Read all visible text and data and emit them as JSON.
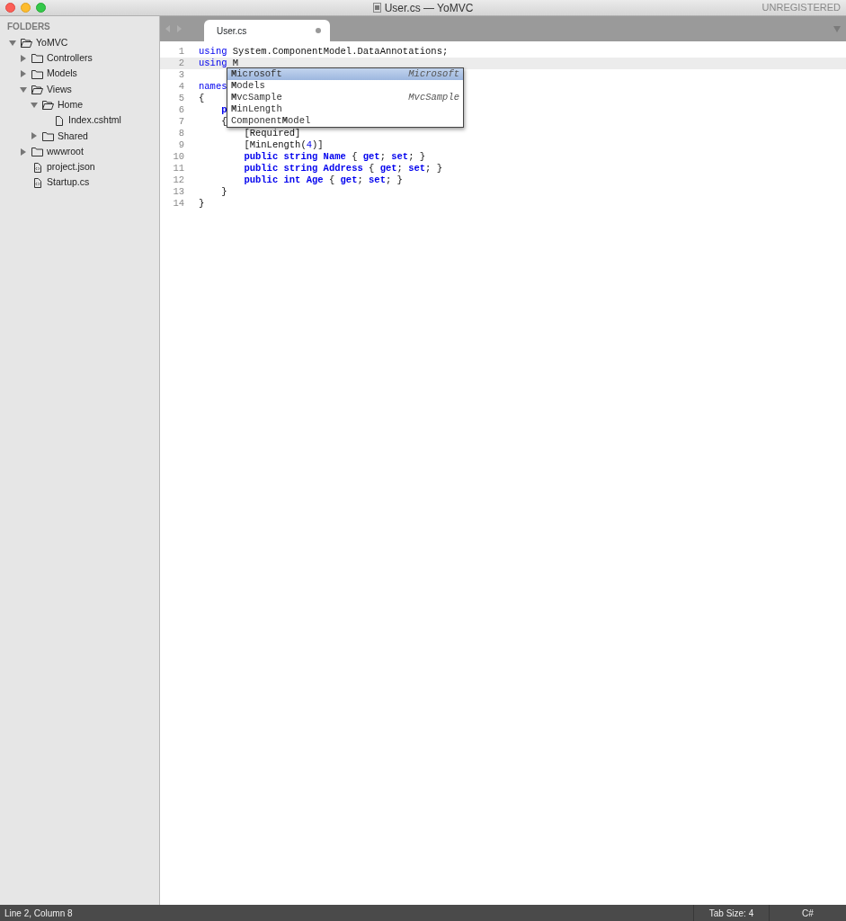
{
  "window": {
    "title": "User.cs — YoMVC",
    "license": "UNREGISTERED"
  },
  "sidebar": {
    "heading": "FOLDERS",
    "tree": [
      {
        "label": "YoMVC",
        "kind": "folder",
        "expanded": true,
        "children": [
          {
            "label": "Controllers",
            "kind": "folder",
            "expanded": false
          },
          {
            "label": "Models",
            "kind": "folder",
            "expanded": false
          },
          {
            "label": "Views",
            "kind": "folder",
            "expanded": true,
            "children": [
              {
                "label": "Home",
                "kind": "folder",
                "expanded": true,
                "children": [
                  {
                    "label": "Index.cshtml",
                    "kind": "file"
                  }
                ]
              },
              {
                "label": "Shared",
                "kind": "folder",
                "expanded": false
              }
            ]
          },
          {
            "label": "wwwroot",
            "kind": "folder",
            "expanded": false
          },
          {
            "label": "project.json",
            "kind": "code-file"
          },
          {
            "label": "Startup.cs",
            "kind": "code-file"
          }
        ]
      }
    ]
  },
  "tabs": [
    {
      "label": "User.cs",
      "selected": true,
      "modified": true
    }
  ],
  "editor": {
    "lines": [
      {
        "number": "1",
        "current": false,
        "tokens": [
          {
            "kind": "kw",
            "text": "using"
          },
          {
            "kind": "plain",
            "text": " System.ComponentModel.DataAnnotations;"
          }
        ]
      },
      {
        "number": "2",
        "current": true,
        "tokens": [
          {
            "kind": "kw",
            "text": "using"
          },
          {
            "kind": "plain",
            "text": " M"
          }
        ]
      },
      {
        "number": "3",
        "current": false
      },
      {
        "number": "4",
        "current": false,
        "tokens": [
          {
            "kind": "kw",
            "text": "names"
          }
        ]
      },
      {
        "number": "5",
        "current": false,
        "tokens": [
          {
            "kind": "plain",
            "text": "{"
          }
        ]
      },
      {
        "number": "6",
        "current": false,
        "tokens": [
          {
            "kind": "kwb",
            "text": "    p"
          }
        ]
      },
      {
        "number": "7",
        "current": false,
        "tokens": [
          {
            "kind": "plain",
            "text": "    {"
          }
        ]
      },
      {
        "number": "8",
        "current": false,
        "tokens": [
          {
            "kind": "plain",
            "text": "        [Required]"
          }
        ]
      },
      {
        "number": "9",
        "current": false,
        "tokens": [
          {
            "kind": "plain",
            "text": "        [MinLength("
          },
          {
            "kind": "num",
            "text": "4"
          },
          {
            "kind": "plain",
            "text": ")]"
          }
        ]
      },
      {
        "number": "10",
        "current": false,
        "tokens": [
          {
            "kind": "kwb",
            "text": "        public string Name"
          },
          {
            "kind": "plain",
            "text": " { "
          },
          {
            "kind": "kwb",
            "text": "get"
          },
          {
            "kind": "plain",
            "text": "; "
          },
          {
            "kind": "kwb",
            "text": "set"
          },
          {
            "kind": "plain",
            "text": "; }"
          }
        ]
      },
      {
        "number": "11",
        "current": false,
        "tokens": [
          {
            "kind": "kwb",
            "text": "        public string Address"
          },
          {
            "kind": "plain",
            "text": " { "
          },
          {
            "kind": "kwb",
            "text": "get"
          },
          {
            "kind": "plain",
            "text": "; "
          },
          {
            "kind": "kwb",
            "text": "set"
          },
          {
            "kind": "plain",
            "text": "; }"
          }
        ]
      },
      {
        "number": "12",
        "current": false,
        "tokens": [
          {
            "kind": "kwb",
            "text": "        public int Age"
          },
          {
            "kind": "plain",
            "text": " { "
          },
          {
            "kind": "kwb",
            "text": "get"
          },
          {
            "kind": "plain",
            "text": "; "
          },
          {
            "kind": "kwb",
            "text": "set"
          },
          {
            "kind": "plain",
            "text": "; }"
          }
        ]
      },
      {
        "number": "13",
        "current": false,
        "tokens": [
          {
            "kind": "plain",
            "text": "    }"
          }
        ]
      },
      {
        "number": "14",
        "current": false,
        "tokens": [
          {
            "kind": "plain",
            "text": "}"
          }
        ]
      }
    ]
  },
  "autocomplete": [
    {
      "text": "**M**icrosoft",
      "hint": "Microsoft",
      "selected": true
    },
    {
      "text": "**M**odels",
      "selected": false
    },
    {
      "text": "**M**vcSample",
      "hint": "MvcSample",
      "selected": false
    },
    {
      "text": "**M**inLength",
      "selected": false
    },
    {
      "text": "Component**M**odel",
      "selected": false
    }
  ],
  "status_bar": {
    "position": "Line 2, Column 8",
    "tab_size": "Tab Size: 4",
    "syntax": "C#"
  }
}
